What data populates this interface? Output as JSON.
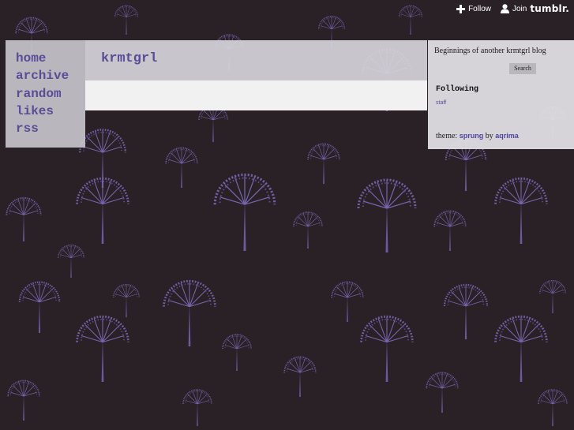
{
  "tumblr_controls": {
    "follow_label": "Follow",
    "join_label": "Join",
    "brand": "tumblr.",
    "follow_icon": "plus-icon",
    "join_icon": "person-icon"
  },
  "nav": {
    "items": [
      {
        "label": "home"
      },
      {
        "label": "archive"
      },
      {
        "label": "random"
      },
      {
        "label": "likes"
      },
      {
        "label": "rss"
      }
    ]
  },
  "main": {
    "blog_title": "krmtgrl"
  },
  "sidebar": {
    "description": "Beginnings of another krmtgrl blog",
    "search_label": "Search",
    "following_heading": "Following",
    "following_users": [
      "staff"
    ],
    "theme_prefix": "theme:",
    "theme_name": "sprung",
    "theme_by": "by",
    "theme_author": "aqrima"
  },
  "colors": {
    "background": "#2a2127",
    "tree_purple": "#6e5fa8",
    "accent_text": "#5a4d96"
  }
}
